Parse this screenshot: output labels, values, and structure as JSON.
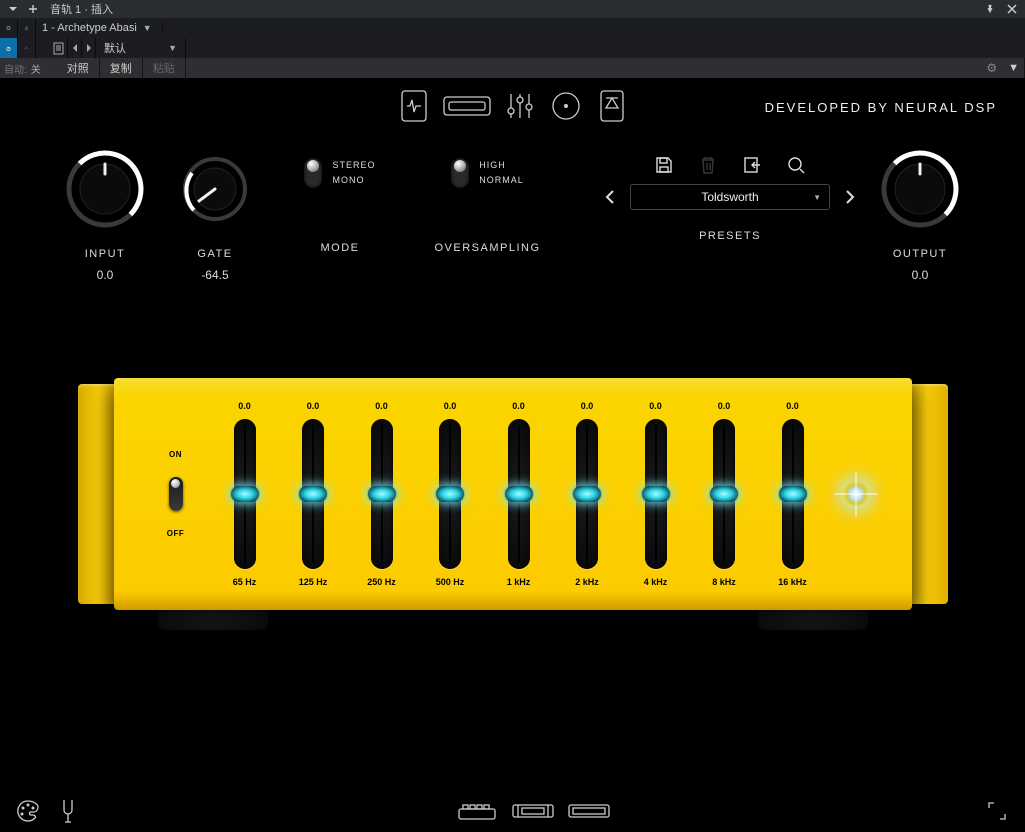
{
  "titlebar": {
    "title": "音轨 1 · 插入"
  },
  "hostbar": {
    "plugin_name": "1 - Archetype Abasi",
    "default_label": "默认",
    "auto_label": "自动:",
    "auto_state": "关",
    "compare": "对照",
    "copy": "复制",
    "paste": "粘贴"
  },
  "header": {
    "developed_by": "DEVELOPED BY NEURAL DSP"
  },
  "controls": {
    "input": {
      "label": "INPUT",
      "value": "0.0"
    },
    "gate": {
      "label": "GATE",
      "value": "-64.5"
    },
    "mode": {
      "label": "MODE",
      "opt_a": "STEREO",
      "opt_b": "MONO"
    },
    "oversampling": {
      "label": "OVERSAMPLING",
      "opt_a": "HIGH",
      "opt_b": "NORMAL"
    },
    "presets": {
      "label": "PRESETS",
      "current": "Toldsworth"
    },
    "output": {
      "label": "OUTPUT",
      "value": "0.0"
    }
  },
  "eq": {
    "on_label": "ON",
    "off_label": "OFF",
    "bands": [
      {
        "value": "0.0",
        "label": "65 Hz"
      },
      {
        "value": "0.0",
        "label": "125 Hz"
      },
      {
        "value": "0.0",
        "label": "250 Hz"
      },
      {
        "value": "0.0",
        "label": "500 Hz"
      },
      {
        "value": "0.0",
        "label": "1 kHz"
      },
      {
        "value": "0.0",
        "label": "2 kHz"
      },
      {
        "value": "0.0",
        "label": "4 kHz"
      },
      {
        "value": "0.0",
        "label": "8 kHz"
      },
      {
        "value": "0.0",
        "label": "16 kHz"
      }
    ]
  },
  "colors": {
    "accent": "#fccb00"
  }
}
